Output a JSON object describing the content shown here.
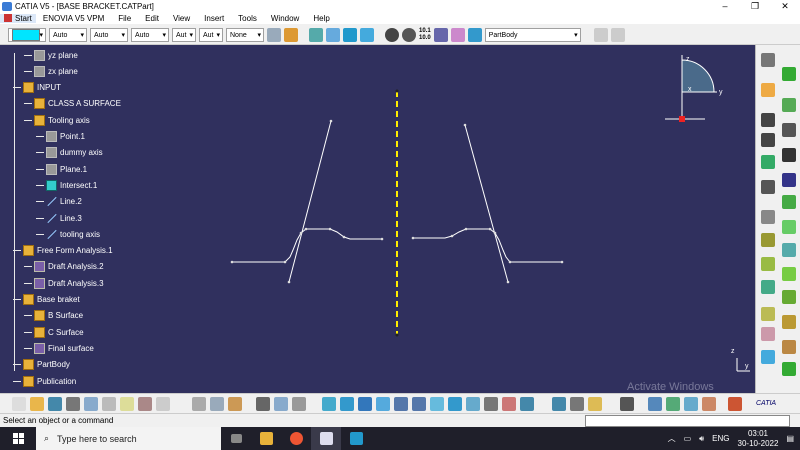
{
  "window": {
    "title": "CATIA V5 - [BASE BRACKET.CATPart]",
    "minimize": "–",
    "restore": "❐",
    "close": "✕"
  },
  "menu": [
    "Start",
    "ENOVIA V5 VPM",
    "File",
    "Edit",
    "View",
    "Insert",
    "Tools",
    "Window",
    "Help"
  ],
  "toolbar": {
    "color_swatch": "#00e5ff",
    "selects": [
      "Auto",
      "Auto",
      "Auto",
      "Aut",
      "Aut",
      "None"
    ],
    "zoom_text": "10.1\n10.0",
    "part_select": "PartBody"
  },
  "tree": {
    "nodes": [
      {
        "label": "yz plane",
        "icon": "plane-icon",
        "kind": "g"
      },
      {
        "label": "zx plane",
        "icon": "plane-icon",
        "kind": "g"
      },
      {
        "label": "INPUT",
        "icon": "geometrical-set-icon",
        "kind": "y"
      },
      {
        "label": "CLASS A SURFACE",
        "icon": "geometrical-set-icon",
        "kind": "y"
      },
      {
        "label": "Tooling axis",
        "icon": "geometrical-set-icon",
        "kind": "y"
      },
      {
        "label": "Point.1",
        "icon": "point-icon",
        "kind": "g"
      },
      {
        "label": "dummy axis",
        "icon": "point-icon",
        "kind": "g"
      },
      {
        "label": "Plane.1",
        "icon": "plane-icon",
        "kind": "g"
      },
      {
        "label": "Intersect.1",
        "icon": "intersect-icon",
        "kind": "c"
      },
      {
        "label": "Line.2",
        "icon": "line-icon",
        "kind": "ln"
      },
      {
        "label": "Line.3",
        "icon": "line-icon",
        "kind": "ln"
      },
      {
        "label": "tooling axis",
        "icon": "line-icon",
        "kind": "ln"
      },
      {
        "label": "Free Form Analysis.1",
        "icon": "geometrical-set-icon",
        "kind": "y"
      },
      {
        "label": "Draft Analysis.2",
        "icon": "draft-analysis-icon",
        "kind": "d"
      },
      {
        "label": "Draft Analysis.3",
        "icon": "draft-analysis-icon",
        "kind": "d"
      },
      {
        "label": "Base braket",
        "icon": "geometrical-set-icon",
        "kind": "y"
      },
      {
        "label": "B Surface",
        "icon": "geometrical-set-icon",
        "kind": "y"
      },
      {
        "label": "C Surface",
        "icon": "geometrical-set-icon",
        "kind": "y"
      },
      {
        "label": "Final surface",
        "icon": "surface-icon",
        "kind": "d"
      },
      {
        "label": "PartBody",
        "icon": "partbody-icon",
        "kind": "y"
      },
      {
        "label": "Publication",
        "icon": "publication-icon",
        "kind": "y"
      }
    ]
  },
  "compass": {
    "z": "z",
    "x": "x",
    "y": "y"
  },
  "axis_triad": {
    "z": "z",
    "y": "y"
  },
  "status": {
    "text": "Select an object or a command",
    "command_input": ""
  },
  "watermark": "Activate Windows",
  "catia_logo": "CATIA",
  "taskbar": {
    "search_placeholder": "Type here to search",
    "language": "ENG",
    "time": "03:01",
    "date": "30-10-2022"
  },
  "colors": {
    "viewport_bg": "#30305e",
    "axis_line": "#ffee00",
    "profile": "#ffffff"
  }
}
